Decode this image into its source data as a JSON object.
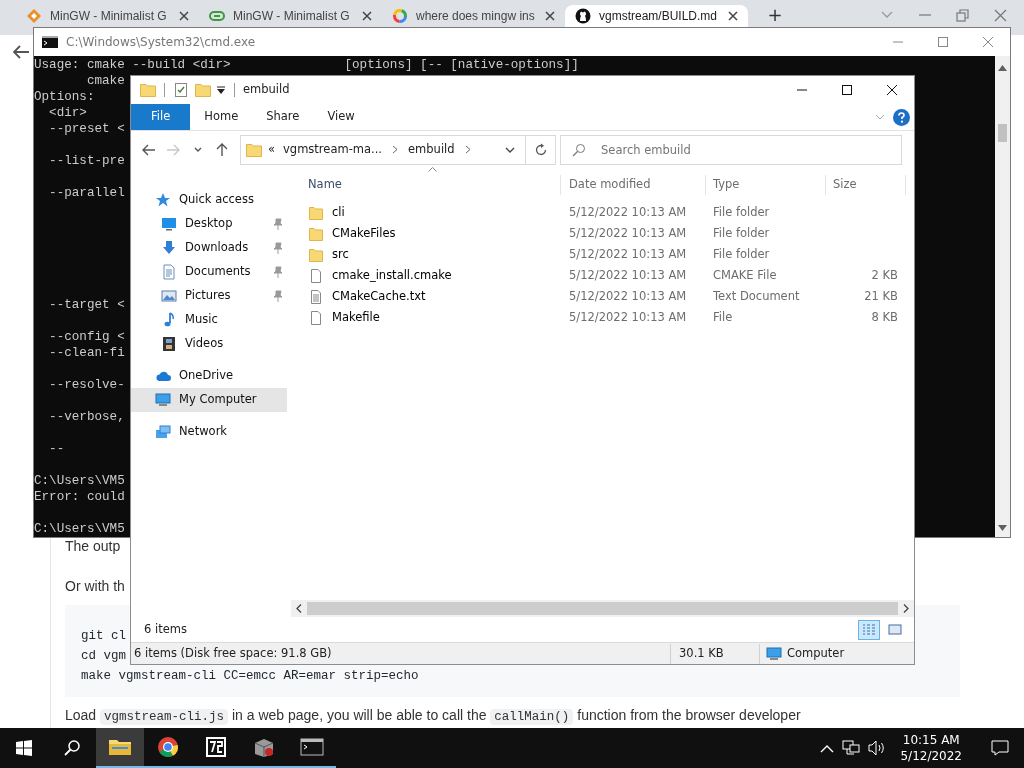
{
  "browser": {
    "tabs": [
      {
        "title": "MinGW - Minimalist G",
        "kind": "diamond",
        "selected": false
      },
      {
        "title": "MinGW - Minimalist G",
        "kind": "capsule",
        "selected": false
      },
      {
        "title": "where does mingw ins",
        "kind": "ring",
        "selected": false
      },
      {
        "title": "vgmstream/BUILD.md",
        "kind": "circle",
        "selected": true
      }
    ],
    "new_tab": "+",
    "page": {
      "paragraphs": [
        "The outp",
        "Or with th"
      ],
      "code_lines": [
        "git cl",
        "cd vgm",
        "make vgmstream-cli CC=emcc AR=emar strip=echo"
      ],
      "last_line": [
        {
          "kind": "text",
          "text": "Load "
        },
        {
          "kind": "code",
          "text": "vgmstream-cli.js"
        },
        {
          "kind": "text",
          "text": " in a web page, you will be able to call the "
        },
        {
          "kind": "code",
          "text": "callMain()"
        },
        {
          "kind": "text",
          "text": " function from the browser developer"
        }
      ]
    }
  },
  "console": {
    "title": "C:\\Windows\\System32\\cmd.exe",
    "lines": [
      {
        "kind": "split",
        "text": "Usage: cmake --build <dir>",
        "tail": "[options] [-- [native-options]]"
      },
      {
        "kind": "text",
        "text": "       cmake"
      },
      {
        "kind": "text",
        "text": "Options:"
      },
      {
        "kind": "text",
        "text": "  <dir>"
      },
      {
        "kind": "text",
        "text": "  --preset <"
      },
      {
        "kind": "blank"
      },
      {
        "kind": "text",
        "text": "  --list-pre"
      },
      {
        "kind": "blank"
      },
      {
        "kind": "text",
        "text": "  --parallel"
      },
      {
        "kind": "blank"
      },
      {
        "kind": "blank"
      },
      {
        "kind": "blank"
      },
      {
        "kind": "blank"
      },
      {
        "kind": "blank"
      },
      {
        "kind": "blank"
      },
      {
        "kind": "text",
        "text": "  --target <"
      },
      {
        "kind": "blank"
      },
      {
        "kind": "text",
        "text": "  --config <"
      },
      {
        "kind": "text",
        "text": "  --clean-fi"
      },
      {
        "kind": "blank"
      },
      {
        "kind": "text",
        "text": "  --resolve-"
      },
      {
        "kind": "blank"
      },
      {
        "kind": "text",
        "text": "  --verbose,"
      },
      {
        "kind": "blank"
      },
      {
        "kind": "text",
        "text": "  --"
      },
      {
        "kind": "blank"
      },
      {
        "kind": "text",
        "text": "C:\\Users\\VM5"
      },
      {
        "kind": "text",
        "text": "Error: could"
      },
      {
        "kind": "blank"
      },
      {
        "kind": "text",
        "text": "C:\\Users\\VM5"
      }
    ]
  },
  "explorer": {
    "title": "embuild",
    "ribbon_tabs": [
      {
        "label": "File",
        "selected": true
      },
      {
        "label": "Home",
        "selected": false
      },
      {
        "label": "Share",
        "selected": false
      },
      {
        "label": "View",
        "selected": false
      }
    ],
    "back": {
      "disabled": false
    },
    "forward": {
      "disabled": true
    },
    "address": {
      "overflow": "«",
      "crumbs": [
        "vgmstream-ma...",
        "embuild"
      ]
    },
    "search": {
      "placeholder": "Search embuild"
    },
    "nav": [
      {
        "label": "Quick access",
        "kind": "star",
        "selected": false,
        "children": [
          {
            "label": "Desktop",
            "kind": "desktop",
            "pinned": true,
            "selected": false
          },
          {
            "label": "Downloads",
            "kind": "download",
            "pinned": true,
            "selected": false
          },
          {
            "label": "Documents",
            "kind": "document",
            "pinned": true,
            "selected": false
          },
          {
            "label": "Pictures",
            "kind": "pictures",
            "pinned": true,
            "selected": false
          },
          {
            "label": "Music",
            "kind": "music",
            "pinned": false,
            "selected": false
          },
          {
            "label": "Videos",
            "kind": "film",
            "pinned": false,
            "selected": false
          }
        ]
      },
      {
        "label": "OneDrive",
        "kind": "cloud",
        "selected": false
      },
      {
        "label": "My Computer",
        "kind": "monitor",
        "selected": true
      },
      {
        "label": "Network",
        "kind": "network",
        "selected": false
      }
    ],
    "columns": [
      {
        "label": "Name",
        "sorted": true
      },
      {
        "label": "Date modified",
        "sorted": false
      },
      {
        "label": "Type",
        "sorted": false
      },
      {
        "label": "Size",
        "sorted": false
      }
    ],
    "files": [
      {
        "name": "cli",
        "date": "5/12/2022 10:13 AM",
        "type": "File folder",
        "kind": "folder"
      },
      {
        "name": "CMakeFiles",
        "date": "5/12/2022 10:13 AM",
        "type": "File folder",
        "kind": "folder"
      },
      {
        "name": "src",
        "date": "5/12/2022 10:13 AM",
        "type": "File folder",
        "kind": "folder"
      },
      {
        "name": "cmake_install.cmake",
        "date": "5/12/2022 10:13 AM",
        "type": "CMAKE File",
        "size": "2 KB",
        "kind": "file"
      },
      {
        "name": "CMakeCache.txt",
        "date": "5/12/2022 10:13 AM",
        "type": "Text Document",
        "size": "21 KB",
        "kind": "text"
      },
      {
        "name": "Makefile",
        "date": "5/12/2022 10:13 AM",
        "type": "File",
        "size": "8 KB",
        "kind": "file"
      }
    ],
    "item_count": "6 items",
    "view_modes": [
      {
        "kind": "details",
        "selected": true
      },
      {
        "kind": "large",
        "selected": false
      }
    ],
    "status_bar": {
      "summary": "6 items (Disk free space: 91.8 GB)",
      "size": "30.1 KB",
      "location": "Computer"
    }
  },
  "taskbar": {
    "apps": [
      {
        "kind": "folder",
        "active": true,
        "running": true
      },
      {
        "kind": "ring",
        "active": false,
        "running": true
      },
      {
        "kind": "archive",
        "active": false,
        "running": true
      },
      {
        "kind": "package",
        "active": false,
        "running": true
      },
      {
        "kind": "console",
        "active": false,
        "running": true
      }
    ],
    "time": "10:15 AM",
    "date": "5/12/2022"
  }
}
